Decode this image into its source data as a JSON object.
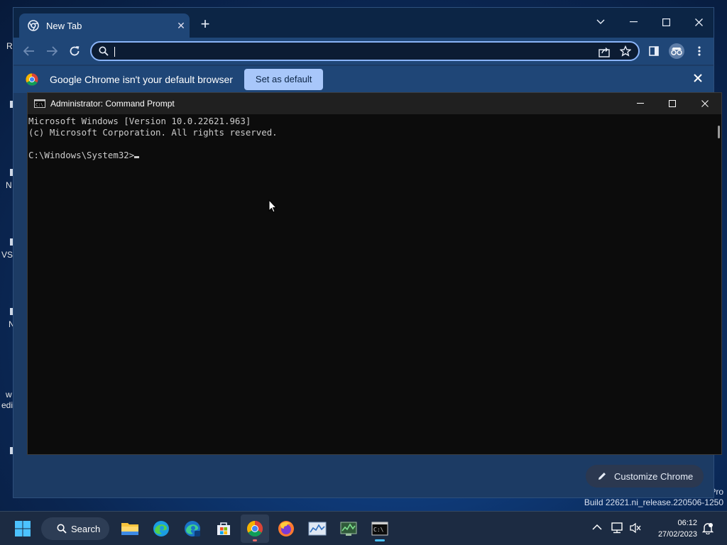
{
  "desktop": {
    "labels": [
      "R",
      "N",
      "VS",
      "N",
      "w",
      "edi"
    ],
    "watermark": {
      "line1": "Pro",
      "line2": "Build 22621.ni_release.220506-1250"
    }
  },
  "chrome": {
    "tab_title": "New Tab",
    "omnibox_value": "",
    "infobar": {
      "message": "Google Chrome isn't your default browser",
      "button": "Set as default"
    },
    "customize_button": "Customize Chrome",
    "colors": {
      "frame": "#0c2545",
      "toolbar": "#1f4677",
      "accent": "#a8c7fa"
    }
  },
  "cmd": {
    "title": "Administrator: Command Prompt",
    "lines": [
      "Microsoft Windows [Version 10.0.22621.963]",
      "(c) Microsoft Corporation. All rights reserved.",
      "",
      "C:\\Windows\\System32>"
    ]
  },
  "taskbar": {
    "search_label": "Search",
    "apps": [
      {
        "name": "file-explorer-icon"
      },
      {
        "name": "edge-icon"
      },
      {
        "name": "edge-beta-icon"
      },
      {
        "name": "microsoft-store-icon"
      },
      {
        "name": "chrome-icon",
        "active": true
      },
      {
        "name": "firefox-icon"
      },
      {
        "name": "resource-monitor-icon"
      },
      {
        "name": "task-manager-icon"
      },
      {
        "name": "command-prompt-icon",
        "running": true
      }
    ],
    "time": "06:12",
    "date": "27/02/2023"
  }
}
